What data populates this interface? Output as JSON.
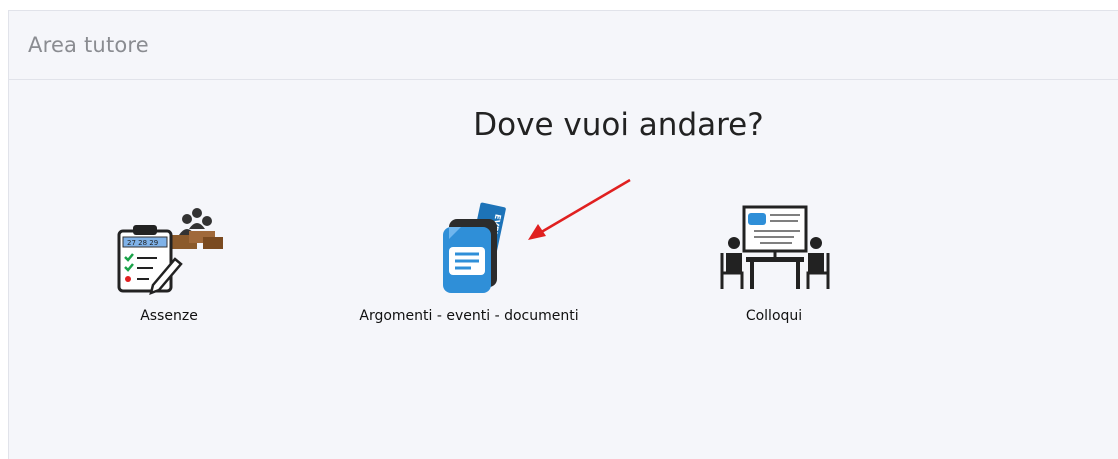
{
  "header": {
    "title": "Area tutore"
  },
  "main": {
    "question": "Dove vuoi andare?",
    "tiles": [
      {
        "label": "Assenze",
        "icon": "attendance-clipboard-icon"
      },
      {
        "label": "Argomenti - eventi - documenti",
        "icon": "event-document-icon"
      },
      {
        "label": "Colloqui",
        "icon": "meeting-whiteboard-icon"
      }
    ]
  },
  "colors": {
    "panel_bg": "#f5f6fa",
    "document_blue": "#2f8fd8",
    "arrow_red": "#e02020"
  }
}
